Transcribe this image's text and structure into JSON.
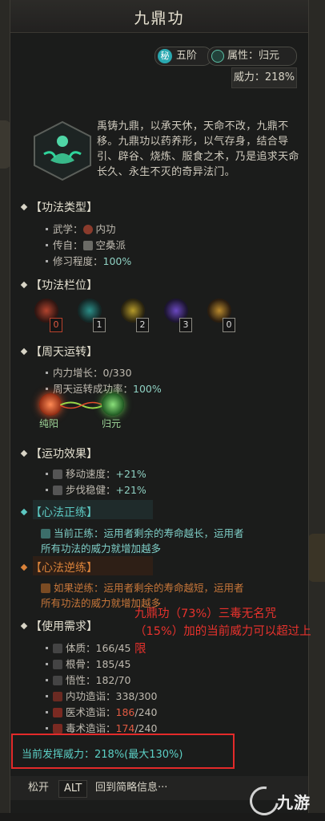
{
  "title": "九鼎功",
  "tier_badge": "秘",
  "tier": "五阶",
  "attribute": "属性：归元",
  "power": "威力：218%",
  "description": "禹铸九鼎，以承天休，天命不改，九鼎不移。九鼎功以药养形，以气存身，结合导引、辟谷、烧炼、服食之术，乃是追求天命长久、永生不灭的奇异法门。",
  "sections": {
    "type": {
      "header": "【功法类型】",
      "rows": [
        {
          "label": "武学：",
          "value": "内功"
        },
        {
          "label": "传自：",
          "value": "空桑派"
        },
        {
          "label": "修习程度：",
          "value": "100%"
        }
      ]
    },
    "slots": {
      "header": "【功法栏位】",
      "values": [
        "0",
        "1",
        "2",
        "3",
        "0"
      ]
    },
    "zhoutian": {
      "header": "【周天运转】",
      "rows": [
        {
          "label": "内力增长：",
          "value": "0/330"
        },
        {
          "label": "周天运转成功率：",
          "value": "100%"
        }
      ],
      "orb_left": "纯阳",
      "orb_right": "归元"
    },
    "effects": {
      "header": "【运功效果】",
      "rows": [
        {
          "label": "移动速度：",
          "value": "+21%"
        },
        {
          "label": "步伐稳健：",
          "value": "+21%"
        }
      ]
    },
    "zheng": {
      "header": "【心法正练】",
      "text1": "当前正练：运用者剩余的寿命越长，运用者",
      "text2": "所有功法的威力就增加越多"
    },
    "ni": {
      "header": "【心法逆练】",
      "text1": "如果逆练：运用者剩余的寿命越短，运用者",
      "text2": "所有功法的威力就增加越多"
    },
    "req": {
      "header": "【使用需求】",
      "rows": [
        {
          "label": "体质：",
          "value": "166",
          "max": "/45"
        },
        {
          "label": "根骨：",
          "value": "185",
          "max": "/45"
        },
        {
          "label": "悟性：",
          "value": "182",
          "max": "/70"
        },
        {
          "label": "内功造诣：",
          "value": "338",
          "max": "/300"
        },
        {
          "label": "医术造诣：",
          "value": "186",
          "max": "/240"
        },
        {
          "label": "毒术造诣：",
          "value": "174",
          "max": "/240"
        }
      ]
    }
  },
  "annotation": "九鼎功（73%）三毒无名咒（15%）加的当前威力可以超过上限",
  "current_power": "当前发挥威力：218%(最大130%)",
  "footer": {
    "release": "松开",
    "key": "ALT",
    "action": "回到简略信息···"
  },
  "watermark": "九游",
  "colors": {
    "teal": "#5cc7c1",
    "orange": "#d9823a",
    "annotation_red": "#e8322d"
  }
}
